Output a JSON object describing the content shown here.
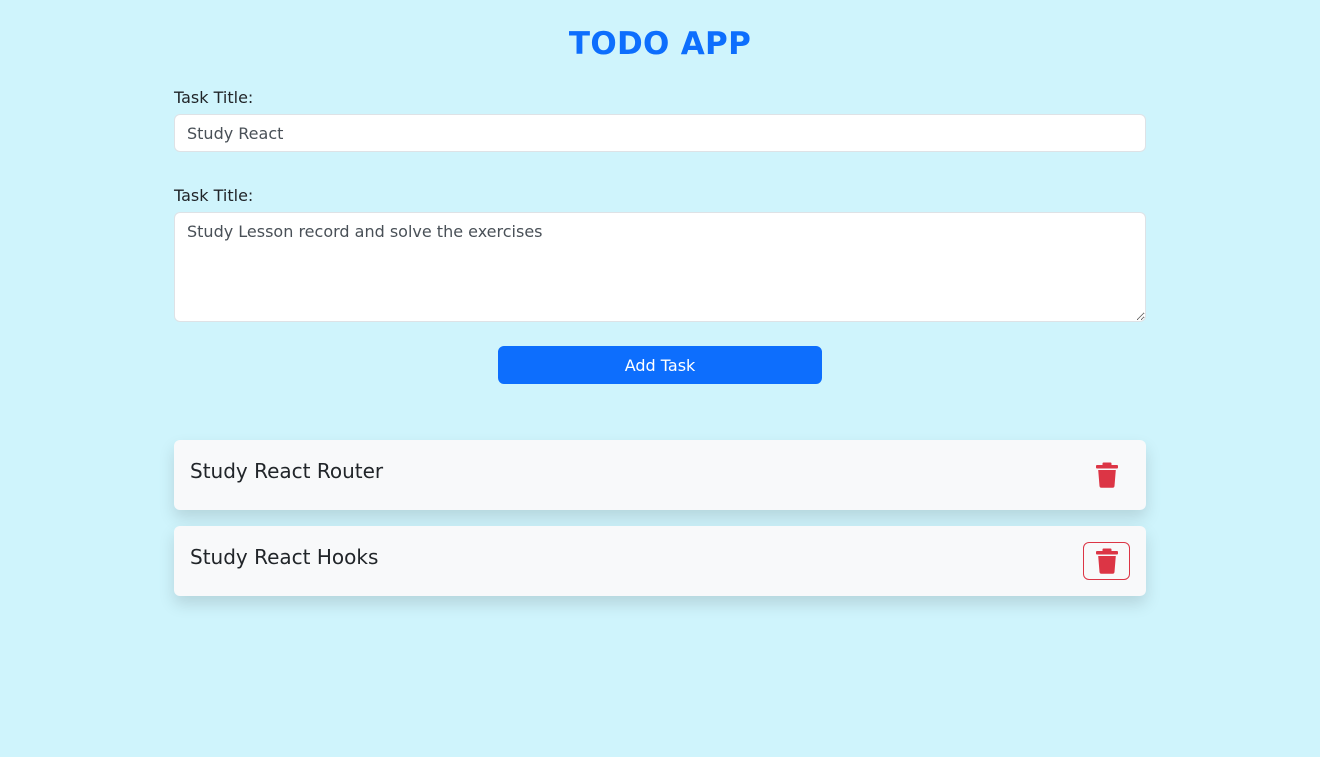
{
  "app": {
    "title": "TODO APP"
  },
  "form": {
    "title_label": "Task Title:",
    "title_value": "Study React",
    "description_label": "Task Title:",
    "description_value": "Study Lesson record and solve the exercises",
    "add_button_label": "Add Task"
  },
  "tasks": [
    {
      "title": "Study React Router",
      "delete_icon": "trash-icon"
    },
    {
      "title": "Study React Hooks",
      "delete_icon": "trash-icon"
    }
  ],
  "colors": {
    "background": "#cff4fc",
    "accent": "#0d6efd",
    "danger": "#dc3545",
    "card": "#f8f9fa"
  }
}
